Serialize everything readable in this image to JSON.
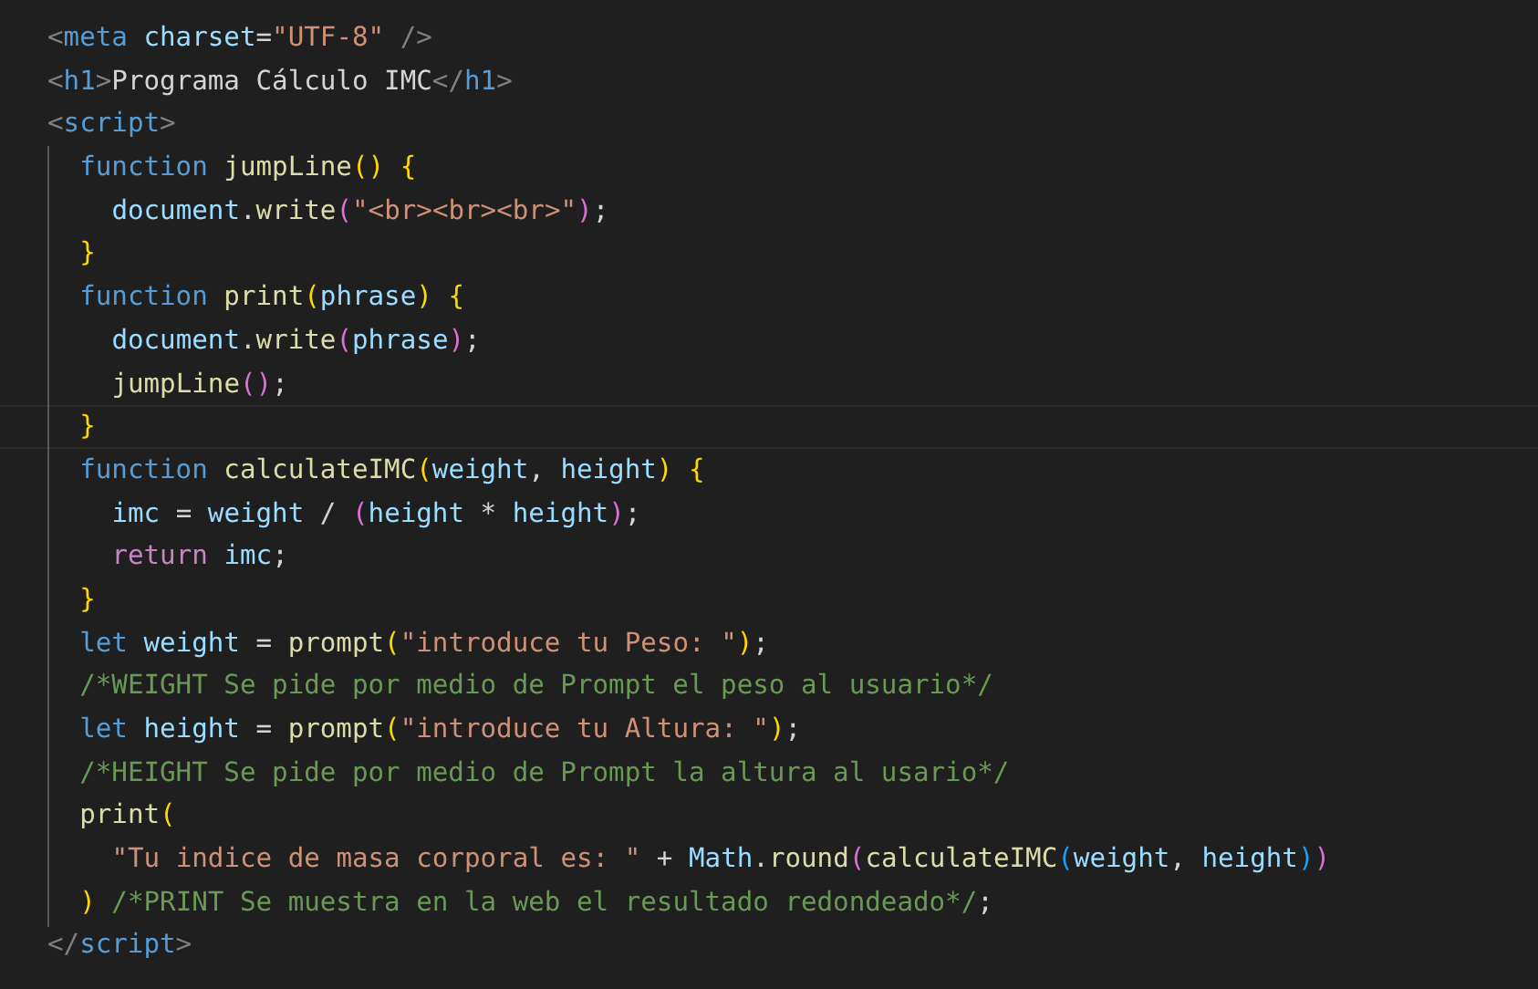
{
  "editor": {
    "lines": [
      {
        "current": false,
        "tokens": [
          {
            "kind": "tag",
            "text": "<"
          },
          {
            "kind": "name",
            "text": "meta"
          },
          {
            "kind": "attr",
            "text": " charset"
          },
          {
            "kind": "p",
            "text": "="
          },
          {
            "kind": "str",
            "text": "\"UTF-8\""
          },
          {
            "kind": "tag",
            "text": " />"
          }
        ]
      },
      {
        "current": false,
        "tokens": [
          {
            "kind": "tag",
            "text": "<"
          },
          {
            "kind": "name",
            "text": "h1"
          },
          {
            "kind": "tag",
            "text": ">"
          },
          {
            "kind": "p",
            "text": "Programa Cálculo IMC"
          },
          {
            "kind": "tag",
            "text": "</"
          },
          {
            "kind": "name",
            "text": "h1"
          },
          {
            "kind": "tag",
            "text": ">"
          }
        ]
      },
      {
        "current": false,
        "tokens": [
          {
            "kind": "tag",
            "text": "<"
          },
          {
            "kind": "name",
            "text": "script"
          },
          {
            "kind": "tag",
            "text": ">"
          }
        ],
        "children": [
          {
            "current": false,
            "tokens": [
              {
                "kind": "kw",
                "text": "function "
              },
              {
                "kind": "fn",
                "text": "jumpLine"
              },
              {
                "kind": "b1",
                "text": "()"
              },
              {
                "kind": "b1",
                "text": " {"
              }
            ],
            "children": [
              {
                "current": false,
                "tokens": [
                  {
                    "kind": "var",
                    "text": "document"
                  },
                  {
                    "kind": "p",
                    "text": "."
                  },
                  {
                    "kind": "fn",
                    "text": "write"
                  },
                  {
                    "kind": "b2",
                    "text": "("
                  },
                  {
                    "kind": "str",
                    "text": "\"<br><br><br>\""
                  },
                  {
                    "kind": "b2",
                    "text": ")"
                  },
                  {
                    "kind": "p",
                    "text": ";"
                  }
                ]
              }
            ]
          },
          {
            "current": false,
            "tokens": [
              {
                "kind": "b1",
                "text": "}"
              }
            ]
          },
          {
            "current": false,
            "tokens": [
              {
                "kind": "kw",
                "text": "function "
              },
              {
                "kind": "fn",
                "text": "print"
              },
              {
                "kind": "b1",
                "text": "("
              },
              {
                "kind": "var",
                "text": "phrase"
              },
              {
                "kind": "b1",
                "text": ")"
              },
              {
                "kind": "b1",
                "text": " {"
              }
            ],
            "children": [
              {
                "current": false,
                "tokens": [
                  {
                    "kind": "var",
                    "text": "document"
                  },
                  {
                    "kind": "p",
                    "text": "."
                  },
                  {
                    "kind": "fn",
                    "text": "write"
                  },
                  {
                    "kind": "b2",
                    "text": "("
                  },
                  {
                    "kind": "var",
                    "text": "phrase"
                  },
                  {
                    "kind": "b2",
                    "text": ")"
                  },
                  {
                    "kind": "p",
                    "text": ";"
                  }
                ]
              },
              {
                "current": false,
                "tokens": [
                  {
                    "kind": "fn",
                    "text": "jumpLine"
                  },
                  {
                    "kind": "b2",
                    "text": "()"
                  },
                  {
                    "kind": "p",
                    "text": ";"
                  }
                ]
              }
            ]
          },
          {
            "current": true,
            "tokens": [
              {
                "kind": "b1",
                "text": "}"
              }
            ]
          },
          {
            "current": false,
            "tokens": [
              {
                "kind": "kw",
                "text": "function "
              },
              {
                "kind": "fn",
                "text": "calculateIMC"
              },
              {
                "kind": "b1",
                "text": "("
              },
              {
                "kind": "var",
                "text": "weight"
              },
              {
                "kind": "p",
                "text": ", "
              },
              {
                "kind": "var",
                "text": "height"
              },
              {
                "kind": "b1",
                "text": ")"
              },
              {
                "kind": "b1",
                "text": " {"
              }
            ],
            "children": [
              {
                "current": false,
                "tokens": [
                  {
                    "kind": "var",
                    "text": "imc"
                  },
                  {
                    "kind": "p",
                    "text": " = "
                  },
                  {
                    "kind": "var",
                    "text": "weight"
                  },
                  {
                    "kind": "p",
                    "text": " / "
                  },
                  {
                    "kind": "b2",
                    "text": "("
                  },
                  {
                    "kind": "var",
                    "text": "height"
                  },
                  {
                    "kind": "p",
                    "text": " * "
                  },
                  {
                    "kind": "var",
                    "text": "height"
                  },
                  {
                    "kind": "b2",
                    "text": ")"
                  },
                  {
                    "kind": "p",
                    "text": ";"
                  }
                ]
              },
              {
                "current": false,
                "tokens": [
                  {
                    "kind": "ctl",
                    "text": "return "
                  },
                  {
                    "kind": "var",
                    "text": "imc"
                  },
                  {
                    "kind": "p",
                    "text": ";"
                  }
                ]
              }
            ]
          },
          {
            "current": false,
            "tokens": [
              {
                "kind": "b1",
                "text": "}"
              }
            ]
          },
          {
            "current": false,
            "tokens": [
              {
                "kind": "kw",
                "text": "let "
              },
              {
                "kind": "var",
                "text": "weight"
              },
              {
                "kind": "p",
                "text": " = "
              },
              {
                "kind": "fn",
                "text": "prompt"
              },
              {
                "kind": "b1",
                "text": "("
              },
              {
                "kind": "str",
                "text": "\"introduce tu Peso: \""
              },
              {
                "kind": "b1",
                "text": ")"
              },
              {
                "kind": "p",
                "text": ";"
              }
            ]
          },
          {
            "current": false,
            "tokens": [
              {
                "kind": "cm",
                "text": "/*WEIGHT Se pide por medio de Prompt el peso al usuario*/"
              }
            ]
          },
          {
            "current": false,
            "tokens": [
              {
                "kind": "kw",
                "text": "let "
              },
              {
                "kind": "var",
                "text": "height"
              },
              {
                "kind": "p",
                "text": " = "
              },
              {
                "kind": "fn",
                "text": "prompt"
              },
              {
                "kind": "b1",
                "text": "("
              },
              {
                "kind": "str",
                "text": "\"introduce tu Altura: \""
              },
              {
                "kind": "b1",
                "text": ")"
              },
              {
                "kind": "p",
                "text": ";"
              }
            ]
          },
          {
            "current": false,
            "tokens": [
              {
                "kind": "cm",
                "text": "/*HEIGHT Se pide por medio de Prompt la altura al usario*/"
              }
            ]
          },
          {
            "current": false,
            "tokens": [
              {
                "kind": "fn",
                "text": "print"
              },
              {
                "kind": "b1",
                "text": "("
              }
            ],
            "children": [
              {
                "current": false,
                "tokens": [
                  {
                    "kind": "str",
                    "text": "\"Tu indice de masa corporal es: \""
                  },
                  {
                    "kind": "p",
                    "text": " + "
                  },
                  {
                    "kind": "var",
                    "text": "Math"
                  },
                  {
                    "kind": "p",
                    "text": "."
                  },
                  {
                    "kind": "fn",
                    "text": "round"
                  },
                  {
                    "kind": "b2",
                    "text": "("
                  },
                  {
                    "kind": "fn",
                    "text": "calculateIMC"
                  },
                  {
                    "kind": "b3",
                    "text": "("
                  },
                  {
                    "kind": "var",
                    "text": "weight"
                  },
                  {
                    "kind": "p",
                    "text": ", "
                  },
                  {
                    "kind": "var",
                    "text": "height"
                  },
                  {
                    "kind": "b3",
                    "text": ")"
                  },
                  {
                    "kind": "b2",
                    "text": ")"
                  }
                ]
              }
            ]
          },
          {
            "current": false,
            "tokens": [
              {
                "kind": "b1",
                "text": ")"
              },
              {
                "kind": "cm",
                "text": " /*PRINT Se muestra en la web el resultado redondeado*/"
              },
              {
                "kind": "p",
                "text": ";"
              }
            ]
          }
        ]
      },
      {
        "current": false,
        "tokens": [
          {
            "kind": "tag",
            "text": "</"
          },
          {
            "kind": "name",
            "text": "script"
          },
          {
            "kind": "tag",
            "text": ">"
          }
        ]
      }
    ]
  }
}
